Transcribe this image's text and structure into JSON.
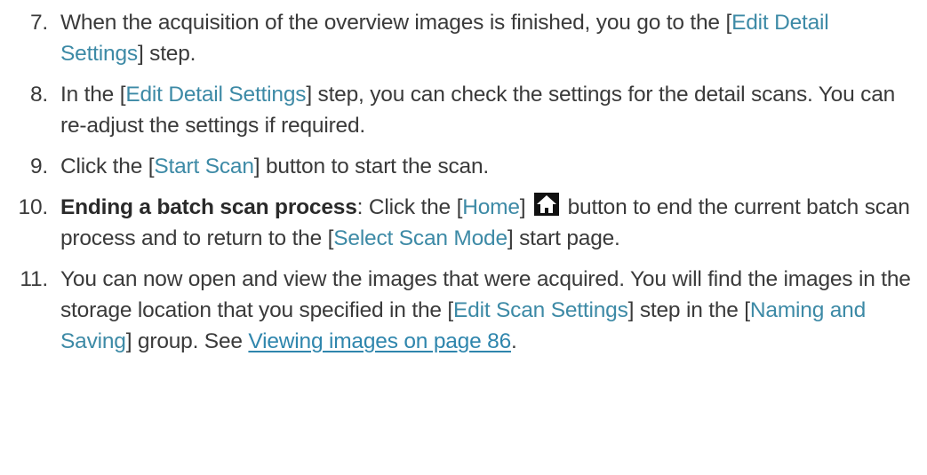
{
  "steps": [
    {
      "number": "7.",
      "pre": "When the acquisition of the overview images is finished, you go to the [",
      "ui1": "Edit Detail Settings",
      "post": "] step."
    },
    {
      "number": "8.",
      "pre": "In the [",
      "ui1": "Edit Detail Settings",
      "post": "] step, you can check the settings for the detail scans. You can re-adjust the settings if required."
    },
    {
      "number": "9.",
      "pre": "Click the [",
      "ui1": "Start Scan",
      "post": "] button to start the scan."
    },
    {
      "number": "10.",
      "bold": "Ending a batch scan process",
      "pre": ": Click the [",
      "ui1": "Home",
      "mid1": "] ",
      "icon": "home-icon",
      "mid2": " button to end the current batch scan process and to return to the [",
      "ui2": "Select Scan Mode",
      "post": "] start page."
    },
    {
      "number": "11.",
      "pre": "You can now open and view the images that were acquired. You will find the images in the storage location that you specified in the [",
      "ui1": "Edit Scan Settings",
      "mid1": "] step in the [",
      "ui2": "Naming and Saving",
      "mid2": "] group. See ",
      "link": "Viewing images on page 86",
      "post": "."
    }
  ],
  "colors": {
    "text": "#3a3a3a",
    "ui_reference": "#3d8aa6",
    "link": "#2f86ad",
    "icon": "#111111"
  }
}
